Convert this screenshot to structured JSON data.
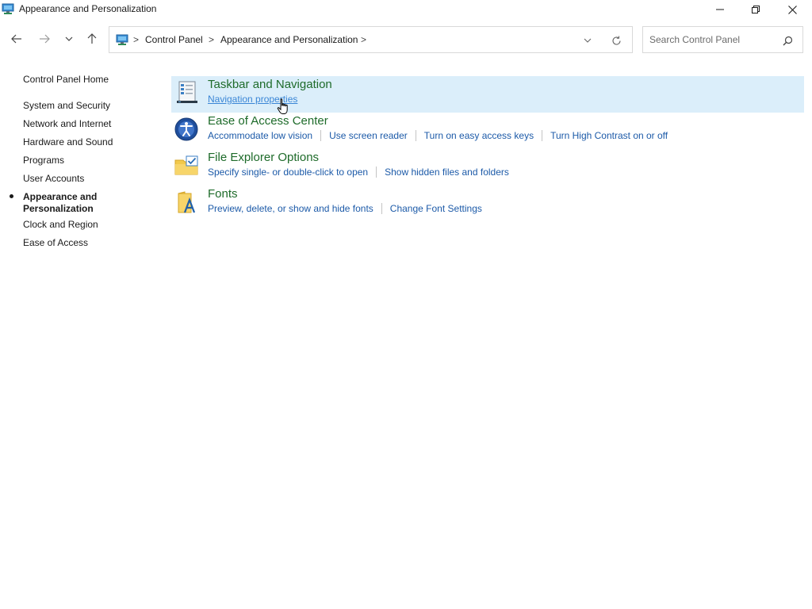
{
  "window": {
    "title": "Appearance and Personalization",
    "icon": "control-panel-icon",
    "controls": [
      "minimize-icon",
      "restore-icon",
      "close-icon"
    ]
  },
  "nav": {
    "back_icon": "arrow-left-icon",
    "forward_icon": "arrow-right-icon",
    "recent_icon": "chevron-down-icon",
    "up_icon": "arrow-up-icon"
  },
  "address": {
    "crumbs": [
      "Control Panel",
      "Appearance and Personalization"
    ],
    "separator": ">"
  },
  "search": {
    "placeholder": "Search Control Panel"
  },
  "sidebar": {
    "home": "Control Panel Home",
    "items": [
      {
        "label": "System and Security"
      },
      {
        "label": "Network and Internet"
      },
      {
        "label": "Hardware and Sound"
      },
      {
        "label": "Programs"
      },
      {
        "label": "User Accounts"
      },
      {
        "label": "Appearance and Personalization",
        "active": true
      },
      {
        "label": "Clock and Region"
      },
      {
        "label": "Ease of Access"
      }
    ]
  },
  "categories": [
    {
      "title": "Taskbar and Navigation",
      "icon": "taskbar-icon",
      "links": [
        "Navigation properties"
      ]
    },
    {
      "title": "Ease of Access Center",
      "icon": "ease-of-access-icon",
      "links": [
        "Accommodate low vision",
        "Use screen reader",
        "Turn on easy access keys",
        "Turn High Contrast on or off"
      ]
    },
    {
      "title": "File Explorer Options",
      "icon": "folder-options-icon",
      "links": [
        "Specify single- or double-click to open",
        "Show hidden files and folders"
      ]
    },
    {
      "title": "Fonts",
      "icon": "fonts-icon",
      "links": [
        "Preview, delete, or show and hide fonts",
        "Change Font Settings"
      ]
    }
  ],
  "colors": {
    "category_title": "#1e6b2a",
    "link": "#1c5aa8",
    "hover_background": "#dbeefa"
  }
}
